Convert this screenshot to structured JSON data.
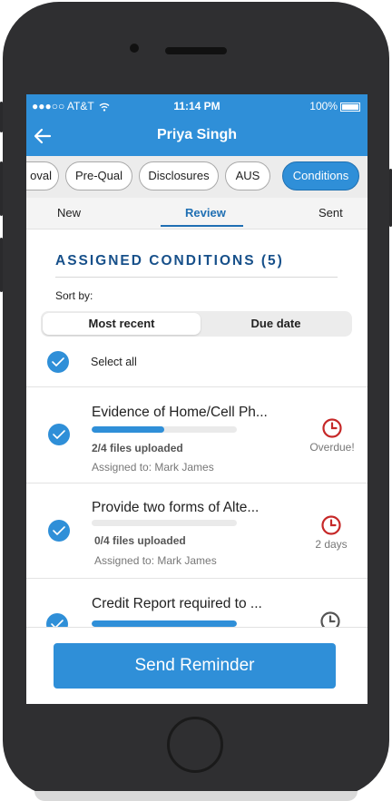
{
  "status_bar": {
    "carrier": "●●●○○ AT&T",
    "time": "11:14 PM",
    "battery": "100%"
  },
  "nav": {
    "title": "Priya Singh",
    "back_icon": "arrow-left-icon"
  },
  "chips": [
    {
      "label": "oval",
      "active": false
    },
    {
      "label": "Pre-Qual",
      "active": false
    },
    {
      "label": "Disclosures",
      "active": false
    },
    {
      "label": "AUS",
      "active": false
    },
    {
      "label": "Conditions",
      "active": true
    }
  ],
  "subtabs": [
    {
      "label": "New",
      "active": false
    },
    {
      "label": "Review",
      "active": true
    },
    {
      "label": "Sent",
      "active": false
    }
  ],
  "section": {
    "title": "ASSIGNED CONDITIONS (5)",
    "sort_label": "Sort by:"
  },
  "sort_options": [
    {
      "label": "Most recent",
      "selected": true
    },
    {
      "label": "Due date",
      "selected": false
    }
  ],
  "select_all": {
    "label": "Select all",
    "checked": true
  },
  "conditions": [
    {
      "title": "Evidence of Home/Cell Ph...",
      "progress": 0.5,
      "files": "2/4 files uploaded",
      "assigned": "Assigned to: Mark James",
      "due": "Overdue!",
      "clock_color": "#c62828",
      "checked": true
    },
    {
      "title": "Provide two forms of Alte...",
      "progress": 0,
      "files": "0/4 files uploaded",
      "assigned": "Assigned to: Mark James",
      "due": "2 days",
      "clock_color": "#c62828",
      "checked": true
    },
    {
      "title": "Credit Report required to ...",
      "progress": 1.0,
      "files": "",
      "assigned": "",
      "due": "",
      "clock_color": "#555555",
      "checked": true
    }
  ],
  "footer": {
    "button_label": "Send Reminder"
  },
  "colors": {
    "accent": "#2f8fd8",
    "title_blue": "#17508a",
    "overdue_red": "#c62828"
  }
}
